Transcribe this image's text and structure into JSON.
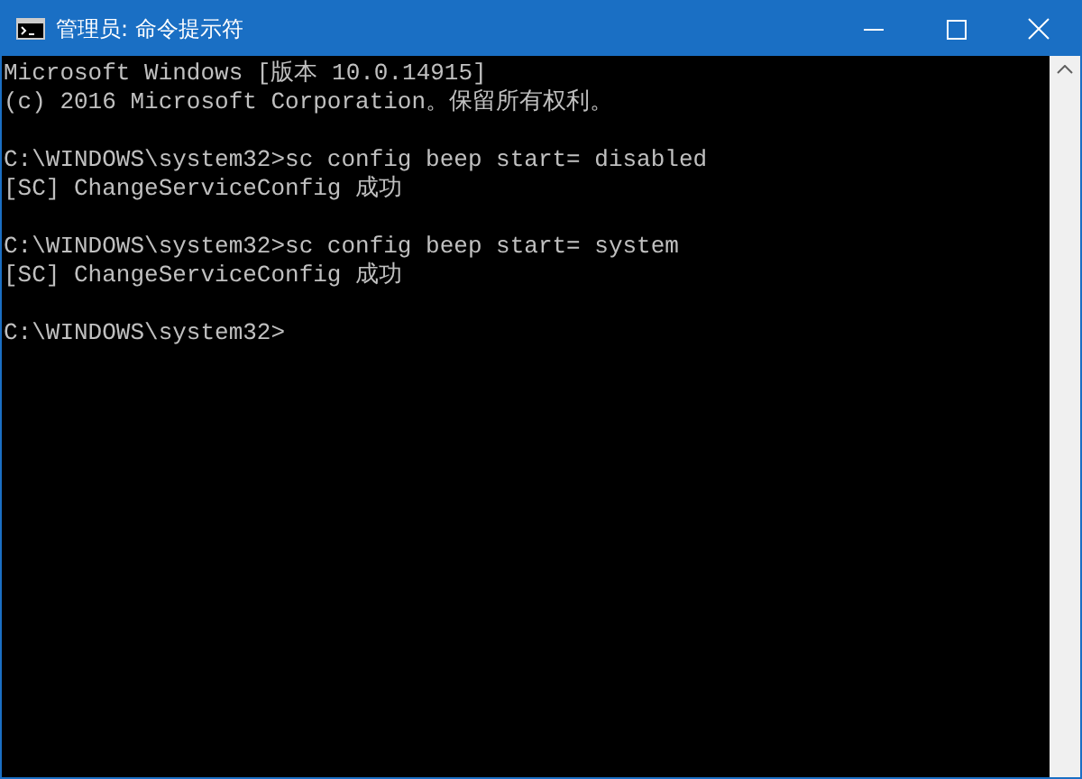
{
  "window": {
    "title": "管理员: 命令提示符"
  },
  "console": {
    "blocks": [
      [
        "Microsoft Windows [版本 10.0.14915]",
        "(c) 2016 Microsoft Corporation。保留所有权利。"
      ],
      [
        "C:\\WINDOWS\\system32>sc config beep start= disabled",
        "[SC] ChangeServiceConfig 成功"
      ],
      [
        "C:\\WINDOWS\\system32>sc config beep start= system",
        "[SC] ChangeServiceConfig 成功"
      ],
      [
        "C:\\WINDOWS\\system32>"
      ]
    ]
  }
}
